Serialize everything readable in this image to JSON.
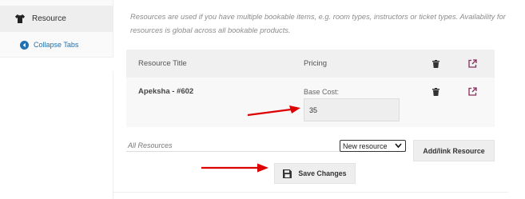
{
  "sidebar": {
    "active_item": "Resource",
    "collapse_label": "Collapse Tabs"
  },
  "description": "Resources are used if you have multiple bookable items, e.g. room types, instructors or ticket types. Availability for resources is global across all bookable products.",
  "table": {
    "headers": {
      "title": "Resource Title",
      "pricing": "Pricing"
    },
    "rows": [
      {
        "title": "Apeksha - #602",
        "base_cost_label": "Base Cost:",
        "base_cost_value": "35"
      }
    ]
  },
  "footer": {
    "all_resources_label": "All Resources",
    "select_value": "New resource",
    "add_button": "Add/link Resource",
    "save_button": "Save Changes"
  },
  "colors": {
    "link_blue": "#2271b1",
    "delete_red": "#cc0000",
    "external_purple": "#8a2d5c",
    "annotation_arrow": "#dd0000"
  }
}
